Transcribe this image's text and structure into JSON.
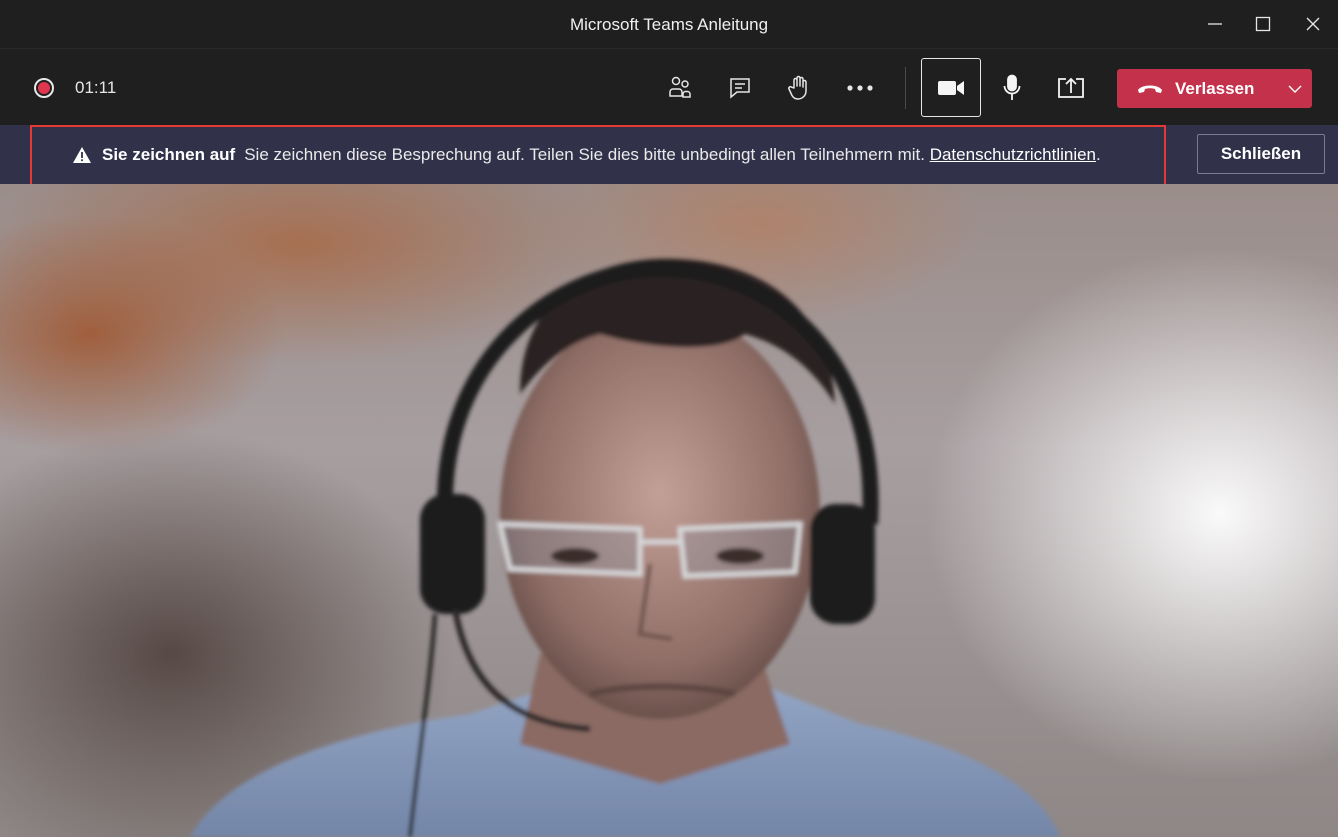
{
  "window": {
    "title": "Microsoft Teams Anleitung"
  },
  "toolbar": {
    "recording_indicator_color": "#e0364f",
    "timer": "01:11",
    "buttons": [
      "people-icon",
      "chat-icon",
      "raise-hand-icon",
      "more-icon",
      "camera-icon",
      "microphone-icon",
      "share-screen-icon"
    ],
    "leave_label": "Verlassen",
    "leave_color": "#c4314b"
  },
  "banner": {
    "title": "Sie zeichnen auf",
    "message": "Sie zeichnen diese Besprechung auf. Teilen Sie dies bitte unbedingt allen Teilnehmern mit.",
    "link_text": "Datenschutzrichtlinien",
    "link_suffix": ".",
    "close_label": "Schließen",
    "highlight_color": "#e53935"
  }
}
